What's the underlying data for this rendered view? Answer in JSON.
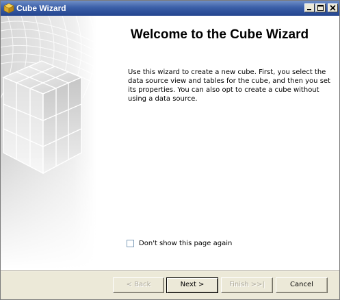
{
  "window": {
    "title": "Cube Wizard",
    "icon": "cube-icon",
    "controls": {
      "minimize_icon": "minimize-icon",
      "maximize_icon": "maximize-icon",
      "close_icon": "close-icon"
    }
  },
  "page": {
    "heading": "Welcome to the Cube Wizard",
    "description": "Use this wizard to create a new cube. First, you select the data source view and tables for the cube, and then you set its properties. You can also opt to create a cube without using a data source.",
    "dont_show_label": "Don't show this page again",
    "dont_show_checked": false
  },
  "buttons": {
    "back": "< Back",
    "next": "Next >",
    "finish": "Finish >>|",
    "cancel": "Cancel"
  },
  "colors": {
    "title_bar": "#3b5fa8",
    "dialog_face": "#ece9d8",
    "disabled_text": "#aca899"
  }
}
